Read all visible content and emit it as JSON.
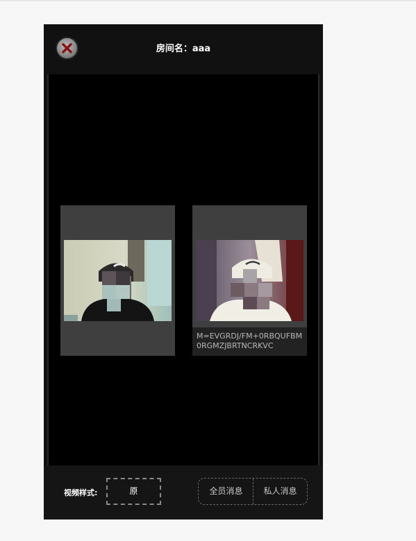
{
  "header": {
    "title": "房间名：aaa",
    "close_icon": "close-x-icon"
  },
  "videos": [
    {
      "id": "local",
      "caption": ""
    },
    {
      "id": "remote",
      "caption": "M=EVGRDJ/FM+0RBQUFBM0RGMZJBRTNCRKVC"
    }
  ],
  "footer": {
    "style_label": "视频样式:",
    "style_value": "原",
    "all_message_label": "全员消息",
    "private_message_label": "私人消息"
  },
  "colors": {
    "close_x": "#8b1010",
    "panel_bg": "#111111",
    "tile_bg": "#3f3f3f"
  }
}
